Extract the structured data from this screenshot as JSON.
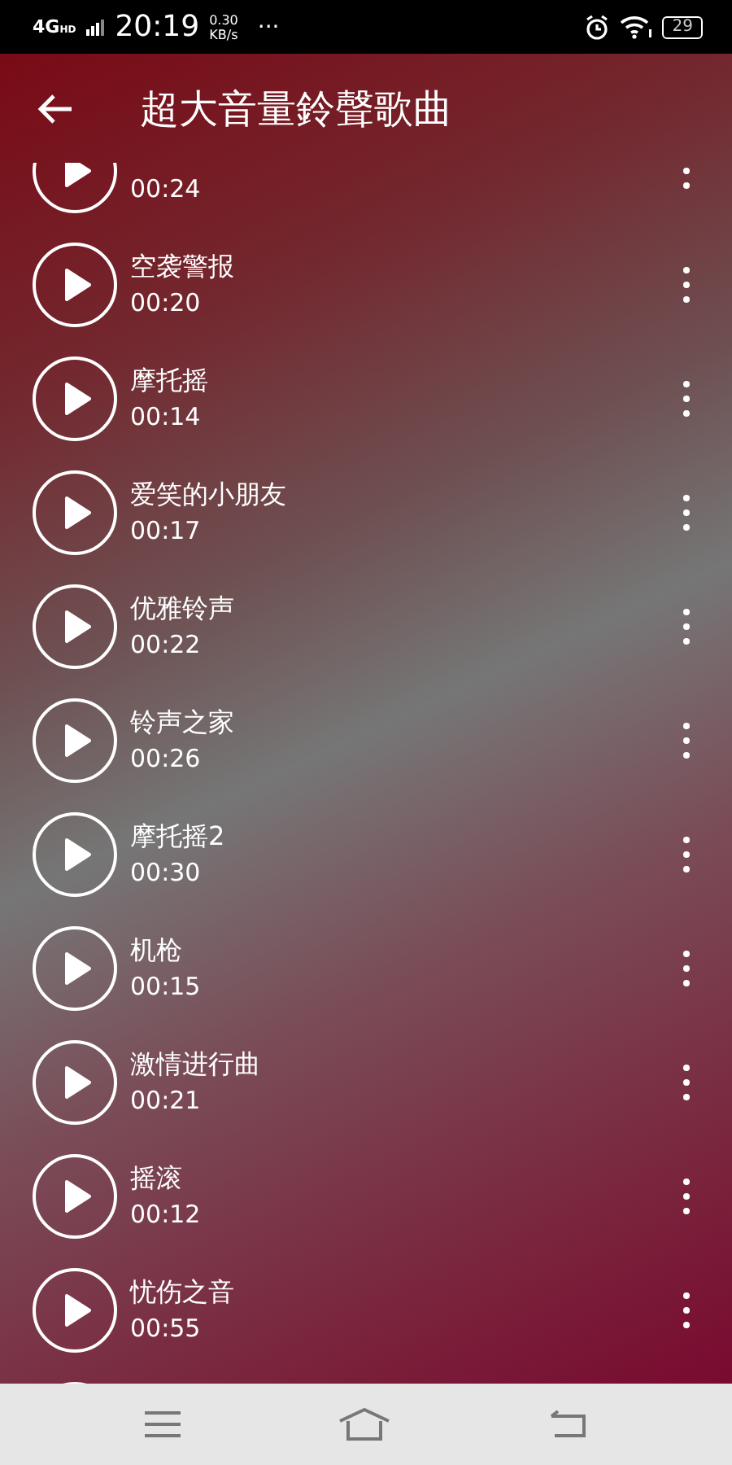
{
  "status_bar": {
    "network": "4G",
    "network_sup": "HD",
    "time": "20:19",
    "speed": "0.30",
    "speed_unit": "KB/s",
    "more": "···",
    "battery": "29"
  },
  "header": {
    "title": "超大音量鈴聲歌曲"
  },
  "tracks": [
    {
      "kind": "partial_top",
      "duration": "00:24"
    },
    {
      "kind": "track",
      "title": "空袭警报",
      "duration": "00:20"
    },
    {
      "kind": "track",
      "title": "摩托摇",
      "duration": "00:14"
    },
    {
      "kind": "track",
      "title": "爱笑的小朋友",
      "duration": "00:17"
    },
    {
      "kind": "track",
      "title": "优雅铃声",
      "duration": "00:22"
    },
    {
      "kind": "track",
      "title": "铃声之家",
      "duration": "00:26"
    },
    {
      "kind": "track",
      "title": "摩托摇2",
      "duration": "00:30"
    },
    {
      "kind": "track",
      "title": "机枪",
      "duration": "00:15"
    },
    {
      "kind": "track",
      "title": "激情进行曲",
      "duration": "00:21"
    },
    {
      "kind": "track",
      "title": "摇滚",
      "duration": "00:12"
    },
    {
      "kind": "track",
      "title": "忧伤之音",
      "duration": "00:55"
    },
    {
      "kind": "partial_bottom"
    }
  ]
}
